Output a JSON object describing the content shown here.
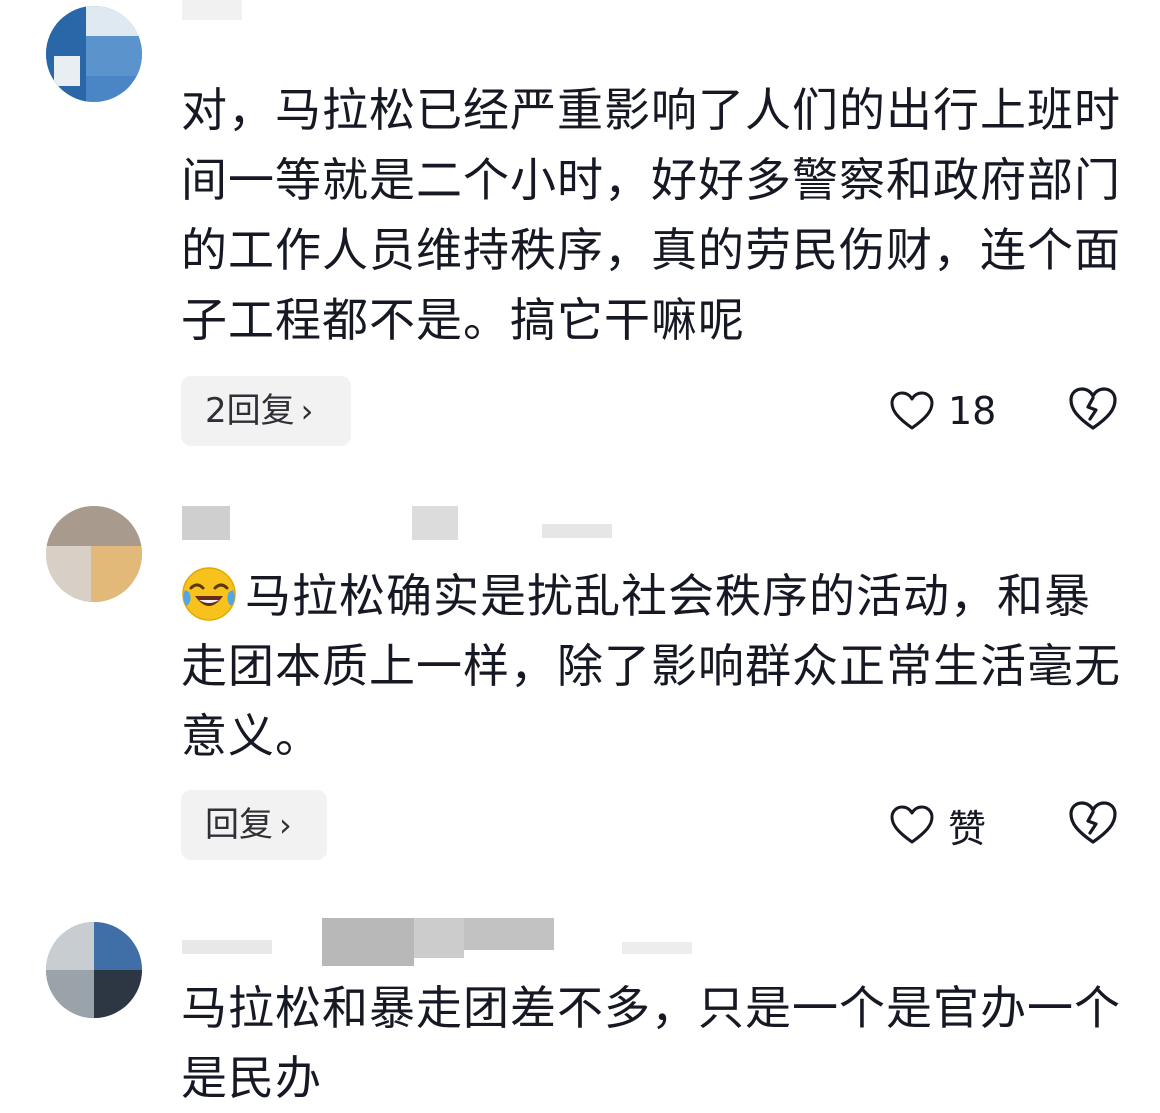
{
  "comments": [
    {
      "text": "对，马拉松已经严重影响了人们的出行上班时间一等就是二个小时，好好多警察和政府部门的工作人员维持秩序，真的劳民伤财，连个面子工程都不是。搞它干嘛呢",
      "reply_label": "2回复",
      "like_label": "18"
    },
    {
      "text": "马拉松确实是扰乱社会秩序的活动，和暴走团本质上一样，除了影响群众正常生活毫无意义。",
      "emoji": "laughing-crying-emoji-icon",
      "reply_label": "回复",
      "like_label": "赞"
    },
    {
      "text": "马拉松和暴走团差不多，只是一个是官办一个是民办"
    }
  ],
  "colors": {
    "text": "#161823",
    "pill_bg": "#f2f2f2",
    "icon_stroke": "#161823"
  }
}
